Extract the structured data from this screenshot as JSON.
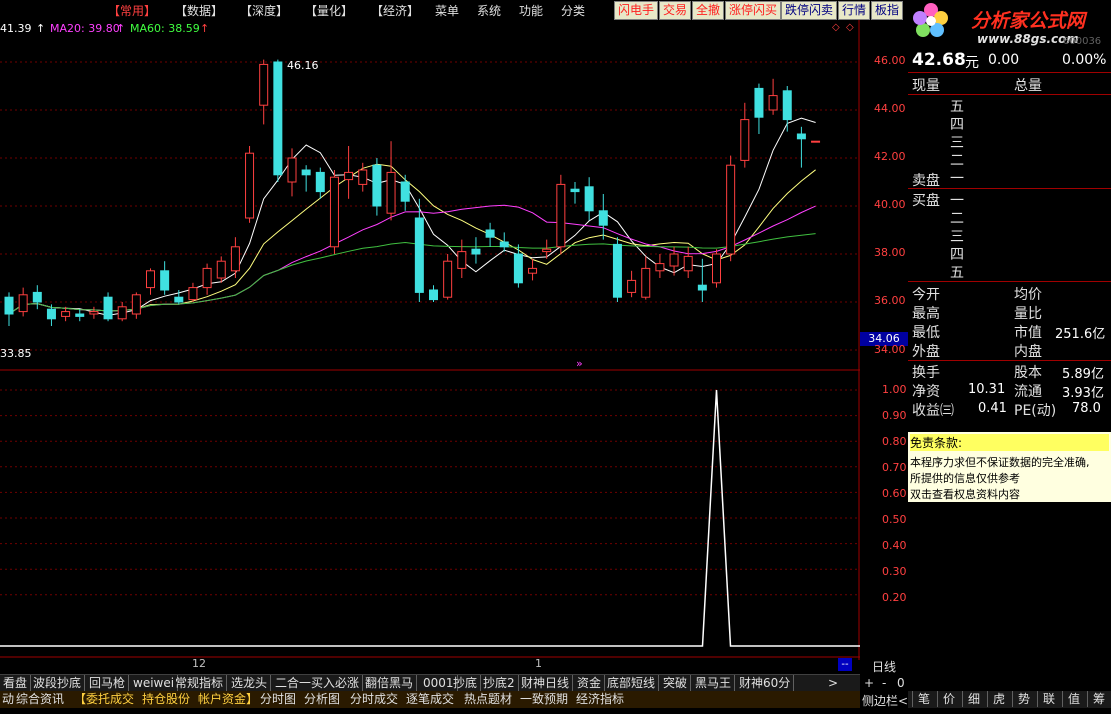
{
  "menu": {
    "items": [
      "【常用】",
      "【数据】",
      "【深度】",
      "【量化】",
      "【经济】",
      "菜单",
      "系统",
      "功能",
      "分类"
    ],
    "toolbar": [
      "闪电手",
      "交易",
      "全撤",
      "涨停闪买",
      "跌停闪卖",
      "行情",
      "板指"
    ]
  },
  "logo": {
    "text": "分析家公式网",
    "url": "www.88gs.com",
    "faint": "600036"
  },
  "indicators": {
    "ma_partial": "41.39",
    "ma20": "MA20: 39.80",
    "ma60": "MA60: 38.59"
  },
  "price_axis": {
    "labels": [
      "46.00",
      "44.00",
      "42.00",
      "40.00",
      "38.00",
      "36.00",
      "34.00"
    ],
    "current": "34.06"
  },
  "lower_axis": {
    "labels": [
      "1.00",
      "0.90",
      "0.80",
      "0.70",
      "0.60",
      "0.50",
      "0.40",
      "0.30",
      "0.20"
    ]
  },
  "chart_labels": {
    "high_marker": "46.16",
    "low_marker": "33.85",
    "date_12": "12",
    "date_1": "1",
    "nav_arrows": "»"
  },
  "chart_data": {
    "type": "candlestick",
    "y_range": [
      34,
      46.4
    ],
    "candles": [
      {
        "o": 36.2,
        "c": 35.5,
        "h": 36.4,
        "l": 35.0
      },
      {
        "o": 35.6,
        "c": 36.3,
        "h": 36.6,
        "l": 35.4
      },
      {
        "o": 36.4,
        "c": 36.0,
        "h": 36.7,
        "l": 35.7
      },
      {
        "o": 35.7,
        "c": 35.3,
        "h": 35.9,
        "l": 35.0
      },
      {
        "o": 35.4,
        "c": 35.6,
        "h": 35.8,
        "l": 35.2
      },
      {
        "o": 35.5,
        "c": 35.4,
        "h": 35.7,
        "l": 35.2
      },
      {
        "o": 35.5,
        "c": 35.6,
        "h": 35.8,
        "l": 35.3
      },
      {
        "o": 36.2,
        "c": 35.3,
        "h": 36.4,
        "l": 35.2
      },
      {
        "o": 35.3,
        "c": 35.8,
        "h": 36.0,
        "l": 35.2
      },
      {
        "o": 35.5,
        "c": 36.3,
        "h": 36.4,
        "l": 35.3
      },
      {
        "o": 36.6,
        "c": 37.3,
        "h": 37.4,
        "l": 36.3
      },
      {
        "o": 37.3,
        "c": 36.5,
        "h": 37.7,
        "l": 36.3
      },
      {
        "o": 36.2,
        "c": 36.0,
        "h": 36.5,
        "l": 35.9
      },
      {
        "o": 36.1,
        "c": 36.6,
        "h": 36.8,
        "l": 36.0
      },
      {
        "o": 36.6,
        "c": 37.4,
        "h": 37.6,
        "l": 36.3
      },
      {
        "o": 37.0,
        "c": 37.7,
        "h": 37.9,
        "l": 36.8
      },
      {
        "o": 37.3,
        "c": 38.3,
        "h": 38.7,
        "l": 37.0
      },
      {
        "o": 39.5,
        "c": 42.2,
        "h": 42.5,
        "l": 39.3
      },
      {
        "o": 44.2,
        "c": 45.9,
        "h": 46.1,
        "l": 43.4
      },
      {
        "o": 46.0,
        "c": 41.3,
        "h": 46.1,
        "l": 41.0
      },
      {
        "o": 41.0,
        "c": 42.0,
        "h": 42.4,
        "l": 40.4
      },
      {
        "o": 41.5,
        "c": 41.3,
        "h": 41.7,
        "l": 40.6
      },
      {
        "o": 41.4,
        "c": 40.6,
        "h": 41.6,
        "l": 40.3
      },
      {
        "o": 38.3,
        "c": 41.2,
        "h": 41.5,
        "l": 38.0
      },
      {
        "o": 41.1,
        "c": 41.4,
        "h": 42.5,
        "l": 40.3
      },
      {
        "o": 40.9,
        "c": 41.5,
        "h": 41.8,
        "l": 40.6
      },
      {
        "o": 41.7,
        "c": 40.0,
        "h": 42.0,
        "l": 39.6
      },
      {
        "o": 39.7,
        "c": 41.4,
        "h": 42.7,
        "l": 39.4
      },
      {
        "o": 41.0,
        "c": 40.2,
        "h": 41.3,
        "l": 39.8
      },
      {
        "o": 39.5,
        "c": 36.4,
        "h": 40.3,
        "l": 36.0
      },
      {
        "o": 36.5,
        "c": 36.1,
        "h": 36.7,
        "l": 36.0
      },
      {
        "o": 36.2,
        "c": 37.7,
        "h": 38.0,
        "l": 36.1
      },
      {
        "o": 37.4,
        "c": 38.1,
        "h": 38.6,
        "l": 37.0
      },
      {
        "o": 38.2,
        "c": 38.0,
        "h": 38.7,
        "l": 37.6
      },
      {
        "o": 39.0,
        "c": 38.7,
        "h": 39.3,
        "l": 38.3
      },
      {
        "o": 38.5,
        "c": 38.3,
        "h": 38.9,
        "l": 38.1
      },
      {
        "o": 38.0,
        "c": 36.8,
        "h": 38.4,
        "l": 36.6
      },
      {
        "o": 37.2,
        "c": 37.4,
        "h": 37.8,
        "l": 36.9
      },
      {
        "o": 38.1,
        "c": 38.2,
        "h": 38.6,
        "l": 37.8
      },
      {
        "o": 38.3,
        "c": 40.9,
        "h": 41.3,
        "l": 38.0
      },
      {
        "o": 40.7,
        "c": 40.6,
        "h": 41.0,
        "l": 40.1
      },
      {
        "o": 40.8,
        "c": 39.8,
        "h": 41.2,
        "l": 39.4
      },
      {
        "o": 39.8,
        "c": 39.2,
        "h": 40.5,
        "l": 38.6
      },
      {
        "o": 38.4,
        "c": 36.2,
        "h": 38.7,
        "l": 36.0
      },
      {
        "o": 36.4,
        "c": 36.9,
        "h": 37.3,
        "l": 36.2
      },
      {
        "o": 36.2,
        "c": 37.4,
        "h": 37.9,
        "l": 36.1
      },
      {
        "o": 37.3,
        "c": 37.6,
        "h": 38.0,
        "l": 37.0
      },
      {
        "o": 37.5,
        "c": 38.0,
        "h": 38.3,
        "l": 37.1
      },
      {
        "o": 37.3,
        "c": 37.9,
        "h": 38.3,
        "l": 37.0
      },
      {
        "o": 36.7,
        "c": 36.5,
        "h": 37.8,
        "l": 36.0
      },
      {
        "o": 36.8,
        "c": 38.0,
        "h": 38.2,
        "l": 36.6
      },
      {
        "o": 38.0,
        "c": 41.7,
        "h": 42.1,
        "l": 37.7
      },
      {
        "o": 41.9,
        "c": 43.6,
        "h": 44.3,
        "l": 41.6
      },
      {
        "o": 44.9,
        "c": 43.7,
        "h": 45.1,
        "l": 43.0
      },
      {
        "o": 44.0,
        "c": 44.6,
        "h": 45.3,
        "l": 43.8
      },
      {
        "o": 44.8,
        "c": 43.6,
        "h": 45.0,
        "l": 43.1
      },
      {
        "o": 43.0,
        "c": 42.8,
        "h": 43.3,
        "l": 41.6
      },
      {
        "o": 42.7,
        "c": 42.7,
        "h": 42.7,
        "l": 42.7
      }
    ],
    "lower_series": {
      "name": "",
      "ylim": [
        0,
        1
      ],
      "spike_index": 50,
      "spike_value": 1.0
    }
  },
  "panel": {
    "price": "42.68",
    "yuan": "元",
    "change": "0.00",
    "pct": "0.00%",
    "xianliang": "现量",
    "zongliang": "总量",
    "sell_levels": [
      "五",
      "四",
      "三",
      "二",
      "一"
    ],
    "buy_levels": [
      "一",
      "二",
      "三",
      "四",
      "五"
    ],
    "maipan": "卖盘",
    "mai2": "买盘",
    "jinkai": "今开",
    "junjia": "均价",
    "zuigao": "最高",
    "liangbi": "量比",
    "zuidi": "最低",
    "shizhi": "市值",
    "shizhi_val": "251.6亿",
    "waipan": "外盘",
    "neipan": "内盘",
    "huanshou": "换手",
    "guben": "股本",
    "guben_val": "5.89亿",
    "jingzi": "净资",
    "jingzi_val": "10.31",
    "liutong": "流通",
    "liutong_val": "3.93亿",
    "shouyi": "收益㈢",
    "shouyi_val": "0.41",
    "pe": "PE(动)",
    "pe_val": "78.0"
  },
  "disclaimer": {
    "title": "免责条款:",
    "lines": [
      "本程序力求但不保证数据的完全准确,",
      "所提供的信息仅供参考",
      "双击查看权息资料内容"
    ]
  },
  "tabs_row1": [
    "看盘",
    "波段抄底",
    "回马枪",
    "weiwei",
    "常规指标",
    "选龙头",
    "二合一买入必涨",
    "翻倍黑马",
    "0001",
    "抄底",
    "抄底2",
    "财神日线",
    "资金",
    "底部短线",
    "突破",
    "黑马王",
    "财神60分"
  ],
  "tabs_row1_more": ">",
  "period_label": "日线",
  "mini_btns": [
    "--",
    "+",
    "-",
    "0"
  ],
  "tabs_row2": [
    "动",
    "综合资讯",
    "【委托成交",
    "持仓股份",
    "帐户资金】",
    "分时图",
    "分析图",
    "分时成交",
    "逐笔成交",
    "热点题材",
    "一致预期",
    "经济指标"
  ],
  "side_label": "侧边栏<",
  "right_tabs": [
    "笔",
    "价",
    "细",
    "虎",
    "势",
    "联",
    "值",
    "筹"
  ]
}
